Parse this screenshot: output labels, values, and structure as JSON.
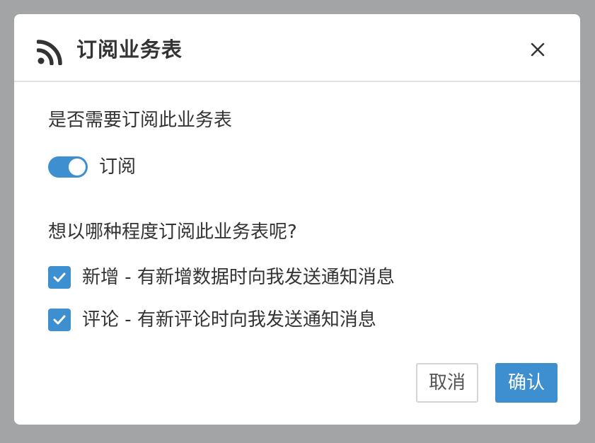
{
  "dialog": {
    "title": "订阅业务表",
    "title_icon": "rss-icon",
    "close_icon": "close-icon"
  },
  "subscribe": {
    "question": "是否需要订阅此业务表",
    "toggle_label": "订阅",
    "toggle_on": true
  },
  "level": {
    "question": "想以哪种程度订阅此业务表呢?",
    "options": [
      {
        "label": "新增 - 有新增数据时向我发送通知消息",
        "checked": true
      },
      {
        "label": "评论 - 有新评论时向我发送通知消息",
        "checked": true
      }
    ]
  },
  "footer": {
    "cancel_label": "取消",
    "ok_label": "确认"
  },
  "colors": {
    "accent": "#3e8fcf",
    "overlay": "#a3a4a6"
  }
}
